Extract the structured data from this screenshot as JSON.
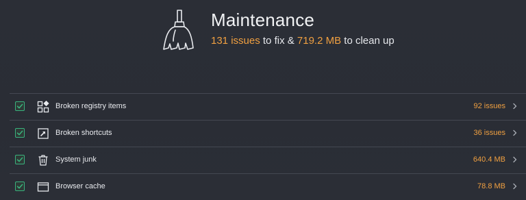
{
  "header": {
    "icon": "broom-icon",
    "title": "Maintenance",
    "summary": {
      "issues_value": "131 issues",
      "issues_suffix": " to fix & ",
      "size_value": "719.2 MB",
      "size_suffix": " to clean up"
    }
  },
  "colors": {
    "accent": "#f0a041",
    "check": "#39b47e",
    "background": "#2b2e36"
  },
  "items": [
    {
      "icon": "registry-icon",
      "label": "Broken registry items",
      "value": "92 issues",
      "checked": true
    },
    {
      "icon": "shortcut-icon",
      "label": "Broken shortcuts",
      "value": "36 issues",
      "checked": true
    },
    {
      "icon": "trash-icon",
      "label": "System junk",
      "value": "640.4 MB",
      "checked": true
    },
    {
      "icon": "browser-icon",
      "label": "Browser cache",
      "value": "78.8 MB",
      "checked": true
    }
  ]
}
